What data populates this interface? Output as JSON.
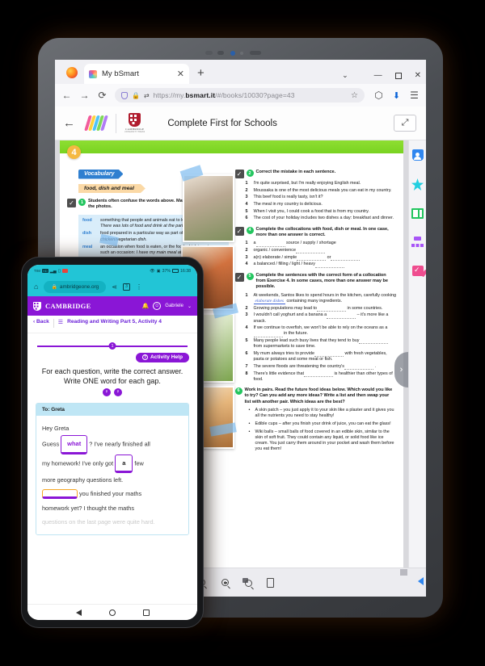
{
  "browser": {
    "tab_title": "My bSmart",
    "tab_close": "✕",
    "new_tab": "+",
    "list_all_tabs": "⌄",
    "minimize": "—",
    "maximize": "❐",
    "close": "✕",
    "back": "←",
    "forward": "→",
    "reload": "⟳",
    "url_prefix": "https://my.",
    "url_domain": "bsmart.it",
    "url_suffix": "/#/books/10030?page=43",
    "bookmark_star": "☆",
    "pocket": "⬡",
    "download": "⬇",
    "menu": "☰"
  },
  "app_header": {
    "back": "←",
    "publisher": "CAMBRIDGE",
    "publisher_sub": "UNIVERSITY PRESS",
    "book_title": "Complete First for Schools",
    "expand": "⤢"
  },
  "book_page": {
    "exercise_number": "4",
    "vocabulary_tag": "Vocabulary",
    "vocabulary_sub": "food, dish and meal",
    "task1": {
      "check": "✓",
      "bubble": "1",
      "audio_bubble": "♪",
      "text": "Students often confuse the words above. Match the definitions to the photos.",
      "definitions": [
        {
          "word": "food",
          "def": "something that people and animals eat to keep them alive: ",
          "ex": "There was lots of food and drink at the party."
        },
        {
          "word": "dish",
          "def": "food prepared in a particular way as part of a meal: ",
          "ex": "a chicken/vegetarian dish."
        },
        {
          "word": "meal",
          "def": "an occasion when food is eaten, or the food which is eaten on such an occasion: ",
          "ex": "I have my main meal at midday. You must come round for a meal sometime."
        }
      ]
    },
    "task2": {
      "check": "✓",
      "bubble": "2",
      "audio_bubble": "♪",
      "text": "Correct the mistake in each sentence.",
      "items": [
        "I'm quite surprised, but I'm really enjoying English meal.",
        "Moussaka is one of the most delicious meals you can eat in my country.",
        "This beef food is really tasty, isn't it?",
        "The meal in my country is delicious.",
        "When I visit you, I could cook a food that is from my country.",
        "The cost of your holiday includes two dishes a day: breakfast and dinner."
      ]
    },
    "task3": {
      "check": "✓",
      "bubble": "4",
      "text": "Complete the collocations with food, dish or meal. In one case, more than one answer is correct.",
      "items": [
        {
          "pre": "a",
          "post": "source / supply / shortage"
        },
        {
          "pre": "organic / convenience",
          "post": ""
        },
        {
          "pre": "a(n) elaborate / simple",
          "post": "or"
        },
        {
          "pre": "a balanced / filling / light / heavy",
          "post": ""
        }
      ]
    },
    "task4": {
      "check": "✓",
      "bubble": "5",
      "text": "Complete the sentences with the correct form of a collocation from Exercise 4. In some cases, more than one answer may be possible.",
      "items": [
        {
          "pre": "At weekends, Santos likes to spend hours in the kitchen, carefully cooking",
          "answer": "elaborate dishes",
          "post": "containing many ingredients."
        },
        {
          "pre": "Growing populations may lead to",
          "answer": "",
          "post": "in some countries."
        },
        {
          "pre": "I wouldn't call yoghurt and a banana a",
          "answer": "",
          "post": "– it's more like a snack."
        },
        {
          "pre": "If we continue to overfish, we won't be able to rely on the oceans as a",
          "answer": "",
          "post": "in the future."
        },
        {
          "pre": "Many people lead such busy lives that they tend to buy",
          "answer": "",
          "post": "from supermarkets to save time."
        },
        {
          "pre": "My mum always tries to provide",
          "answer": "",
          "post": "with fresh vegetables, pasta or potatoes and some meat or fish."
        },
        {
          "pre": "The severe floods are threatening the country's",
          "answer": "",
          "post": "."
        },
        {
          "pre": "There's little evidence that",
          "answer": "",
          "post": "is healthier than other types of food."
        }
      ]
    },
    "task5": {
      "bubble": "6",
      "text": "Work in pairs. Read the future food ideas below. Which would you like to try? Can you add any more ideas? Write a list and then swap your list with another pair. Which ideas are the best?",
      "bullets": [
        "A skin patch – you just apply it to your skin like a plaster and it gives you all the nutrients you need to stay healthy!",
        "Edible cups – after you finish your drink of juice, you can eat the glass!",
        "Wiki balls – small balls of food covered in an edible skin, similar to the skin of soft fruit. They could contain any liquid, or solid food like ice cream. You just carry them around in your pocket and wash them before you eat them!"
      ]
    },
    "next_page": "›"
  },
  "sidebar": {
    "items": [
      {
        "name": "profile"
      },
      {
        "name": "favourites"
      },
      {
        "name": "book"
      },
      {
        "name": "sitemap"
      },
      {
        "name": "assignments"
      }
    ]
  },
  "bottom_toolbar": {
    "tools": [
      "select",
      "toolbox",
      "bookmark",
      "zoom-out",
      "zoom-in",
      "area-zoom",
      "page-view"
    ]
  },
  "phone": {
    "status": {
      "carrier": "TIM",
      "battery_pct": "37%",
      "time": "16:38"
    },
    "browser": {
      "home": "⌂",
      "lock": "🔒",
      "url": "ambridgeone.org",
      "share": "≺",
      "tab_count": "3",
      "menu": "⋮"
    },
    "header": {
      "brand": "CAMBRIDGE",
      "bell": "🔔",
      "user": "Gabriele",
      "chevron": "⌄"
    },
    "breadcrumb": {
      "back": "‹ Back",
      "lines_icon": "☰",
      "title": "Reading and Writing Part 5, Activity 4"
    },
    "progress": {
      "step": "1"
    },
    "help_button": {
      "icon": "?",
      "label": "Activity Help"
    },
    "instructions_line1": "For each question, write the correct answer.",
    "instructions_line2": "Write ONE word for each gap.",
    "bulbs": [
      "♀",
      "♀"
    ],
    "letter": {
      "to": "To: Greta",
      "greeting": "Hey Greta",
      "line1_pre": "Guess",
      "gap1": "what",
      "line1_post": "? I've nearly finished all",
      "line2_pre": "my homework! I've only got",
      "gap2": "a",
      "line2_post": "few",
      "line3": "more geography questions left.",
      "gap3": "",
      "line4_post": "you finished your maths",
      "line5": "homework yet? I thought the maths",
      "line6": "questions on the last page were quite hard."
    },
    "navbar": {
      "back": "◁",
      "home": "○",
      "recents": "□"
    }
  }
}
